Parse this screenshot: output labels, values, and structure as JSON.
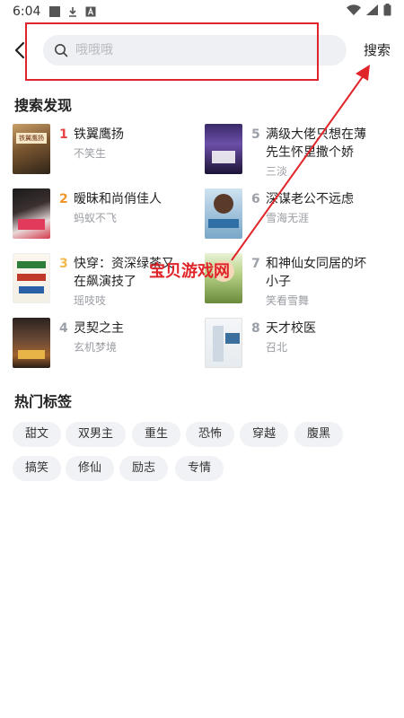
{
  "status_bar": {
    "time": "6:04"
  },
  "header": {
    "search_placeholder": "哦哦哦",
    "search_button": "搜索"
  },
  "discover": {
    "title": "搜索发现",
    "books": [
      {
        "rank": "1",
        "title": "铁翼鹰扬",
        "author": "不笑生"
      },
      {
        "rank": "5",
        "title": "满级大佬只想在薄先生怀里撒个娇",
        "author": "三淡"
      },
      {
        "rank": "2",
        "title": "暧昧和尚俏佳人",
        "author": "蚂蚁不飞"
      },
      {
        "rank": "6",
        "title": "深谋老公不远虑",
        "author": "雪海无涯"
      },
      {
        "rank": "3",
        "title": "快穿：资深绿茶又在飙演技了",
        "author": "瑶吱吱"
      },
      {
        "rank": "7",
        "title": "和神仙女同居的坏小子",
        "author": "笑看雪舞"
      },
      {
        "rank": "4",
        "title": "灵契之主",
        "author": "玄机梦境"
      },
      {
        "rank": "8",
        "title": "天才校医",
        "author": "召北"
      }
    ]
  },
  "hot_tags": {
    "title": "热门标签",
    "tags": [
      "甜文",
      "双男主",
      "重生",
      "恐怖",
      "穿越",
      "腹黑",
      "搞笑",
      "修仙",
      "励志",
      "专情"
    ]
  },
  "watermark": "宝贝游戏网",
  "colors": {
    "accent_red": "#e0252a",
    "rank1": "#e64545",
    "rank2": "#f0952a",
    "rank3": "#f2b84b",
    "rank_other": "#9ca0a8"
  }
}
